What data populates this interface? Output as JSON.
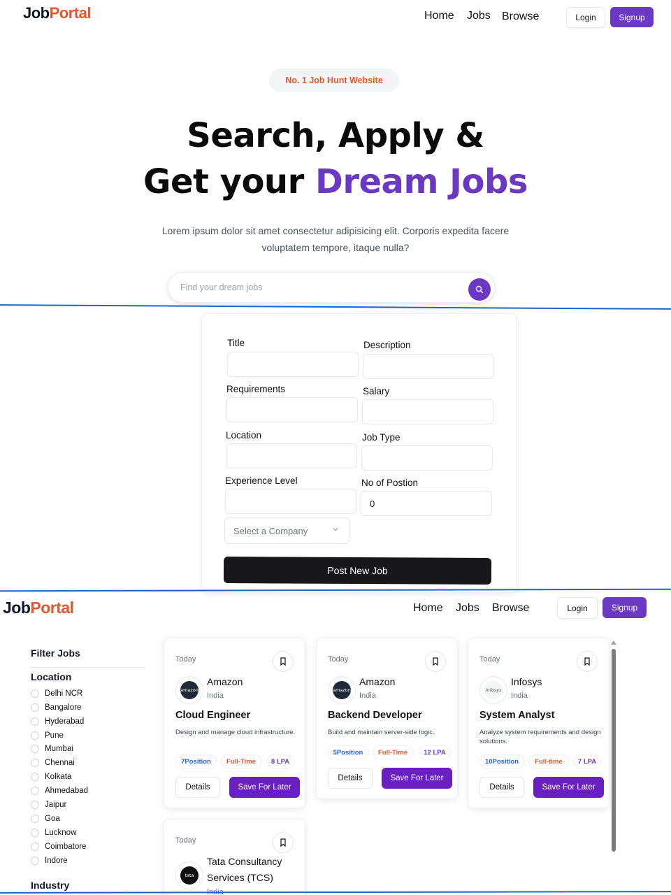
{
  "hero_nav": {
    "logo_part1": "Job",
    "logo_part2": "Portal",
    "links": [
      "Home",
      "Jobs",
      "Browse"
    ],
    "login": "Login",
    "signup": "Signup"
  },
  "hero": {
    "badge": "No. 1 Job Hunt Website",
    "headline_line1": "Search, Apply &",
    "headline_line2_plain": "Get your ",
    "headline_line2_accent": "Dream Jobs",
    "description": "Lorem ipsum dolor sit amet consectetur adipisicing elit. Corporis expedita facere voluptatem tempore, itaque nulla?",
    "search_placeholder": "Find your dream jobs"
  },
  "post_job_form": {
    "fields": [
      {
        "label": "Title",
        "value": ""
      },
      {
        "label": "Description",
        "value": ""
      },
      {
        "label": "Requirements",
        "value": ""
      },
      {
        "label": "Salary",
        "value": ""
      },
      {
        "label": "Location",
        "value": ""
      },
      {
        "label": "Job Type",
        "value": ""
      },
      {
        "label": "Experience Level",
        "value": ""
      },
      {
        "label": "No of Postion",
        "value": "0"
      }
    ],
    "company_select": "Select a Company",
    "submit": "Post New Job"
  },
  "jobs_nav": {
    "logo_part1": "Job",
    "logo_part2": "Portal",
    "links": [
      "Home",
      "Jobs",
      "Browse"
    ],
    "login": "Login",
    "signup": "Signup"
  },
  "filters": {
    "title": "Filter Jobs",
    "location_heading": "Location",
    "locations": [
      "Delhi NCR",
      "Bangalore",
      "Hyderabad",
      "Pune",
      "Mumbai",
      "Chennai",
      "Kolkata",
      "Ahmedabad",
      "Jaipur",
      "Goa",
      "Lucknow",
      "Coimbatore",
      "Indore"
    ],
    "industry_heading": "Industry"
  },
  "jobs": [
    {
      "posted": "Today",
      "company": "Amazon",
      "logo_text": "amazon",
      "country": "India",
      "title": "Cloud Engineer",
      "description": "Design and manage cloud infrastructure.",
      "positions": "7Position",
      "job_type": "Full-Time",
      "salary": "8 LPA",
      "details": "Details",
      "save": "Save For Later"
    },
    {
      "posted": "Today",
      "company": "Amazon",
      "logo_text": "amazon",
      "country": "India",
      "title": "Backend Developer",
      "description": "Build and maintain server-side logic.",
      "positions": "5Position",
      "job_type": "Full-Time",
      "salary": "12 LPA",
      "details": "Details",
      "save": "Save For Later"
    },
    {
      "posted": "Today",
      "company": "Infosys",
      "logo_text": "Infosys",
      "country": "India",
      "title": "System Analyst",
      "description": "Analyze system requirements and design solutions.",
      "positions": "10Position",
      "job_type": "Full-time",
      "salary": "7 LPA",
      "details": "Details",
      "save": "Save For Later"
    },
    {
      "posted": "Today",
      "company_line1": "Tata Consultancy",
      "company_line2": "Services (TCS)",
      "logo_text": "tata",
      "country": "India"
    }
  ],
  "colors": {
    "brand_purple": "#6a38c2",
    "logo_accent": "#e4572e",
    "divider_blue": "#1e63c7"
  }
}
